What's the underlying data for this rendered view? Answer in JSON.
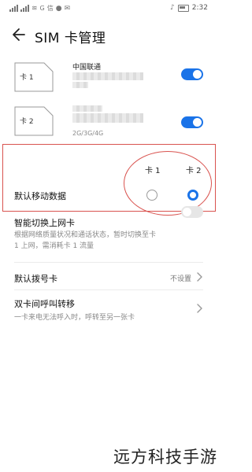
{
  "status_bar": {
    "carrier_left": "令",
    "carrier_text": "⋯ᵢ",
    "time": "2:32",
    "app_tags": [
      "G",
      "信"
    ]
  },
  "header": {
    "title": "SIM 卡管理"
  },
  "sims": [
    {
      "card_label": "卡 1",
      "carrier": "中国联通",
      "network_type": "",
      "enabled": true
    },
    {
      "card_label": "卡 2",
      "carrier": "",
      "network_type": "2G/3G/4G",
      "enabled": true
    }
  ],
  "default_data": {
    "label": "默认移动数据",
    "columns": [
      "卡 1",
      "卡 2"
    ],
    "selected": "卡 2"
  },
  "smart_switch": {
    "title": "智能切换上网卡",
    "description": "根据网络质量状况和通话状态，暂时切换至卡 1 上网，需消耗卡 1 流量",
    "enabled": false
  },
  "default_dial": {
    "label": "默认拨号卡",
    "value": "不设置"
  },
  "call_forwarding": {
    "title": "双卡间呼叫转移",
    "description": "一卡来电无法呼入时，呼转至另一张卡"
  },
  "watermark": "远方科技手游",
  "colors": {
    "accent": "#1a73e8",
    "annotation": "#d9534f"
  }
}
